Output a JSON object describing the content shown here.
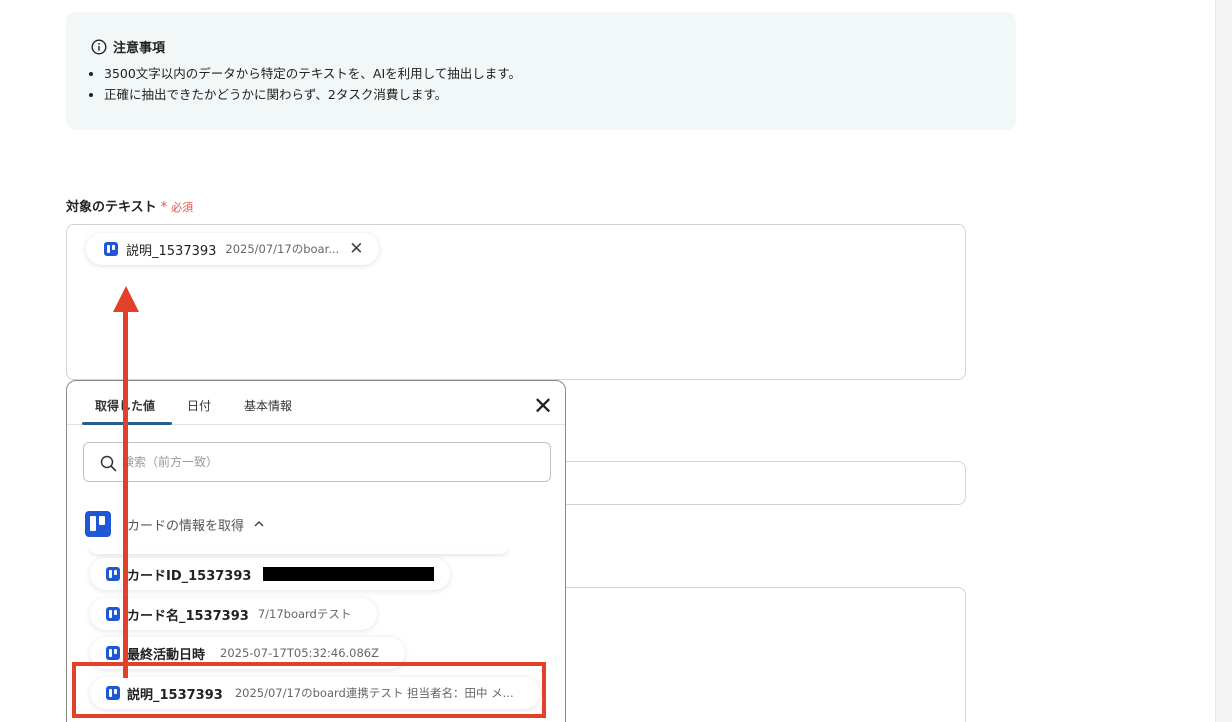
{
  "notice": {
    "title": "注意事項",
    "items": [
      "3500文字以内のデータから特定のテキストを、AIを利用して抽出します。",
      "正確に抽出できたかどうかに関わらず、2タスク消費します。"
    ]
  },
  "field": {
    "label": "対象のテキスト",
    "required_star": "*",
    "required_text": "必須",
    "selected_chip": {
      "label": "説明_1537393",
      "value": "2025/07/17のboar..."
    }
  },
  "popup": {
    "tabs": [
      "取得した値",
      "日付",
      "基本情報"
    ],
    "search_placeholder": "検索（前方一致）",
    "group_label": "カードの情報を取得",
    "items": [
      {
        "label": "カードID_1537393",
        "value": ""
      },
      {
        "label": "カード名_1537393",
        "value": "7/17boardテスト"
      },
      {
        "label": "最終活動日時",
        "value": "2025-07-17T05:32:46.086Z"
      },
      {
        "label": "説明_1537393",
        "value": "2025/07/17のboard連携テスト 担当者名：田中 メ..."
      }
    ]
  },
  "colors": {
    "annotation": "#e3402a",
    "trello_blue": "#1f58d6",
    "required": "#e25050",
    "tab_underline": "#2a5f8a"
  },
  "icons": {
    "info": "info-icon",
    "close": "close-icon",
    "search": "search-icon",
    "chevron": "chevron-up-icon",
    "app": "trello-icon"
  }
}
